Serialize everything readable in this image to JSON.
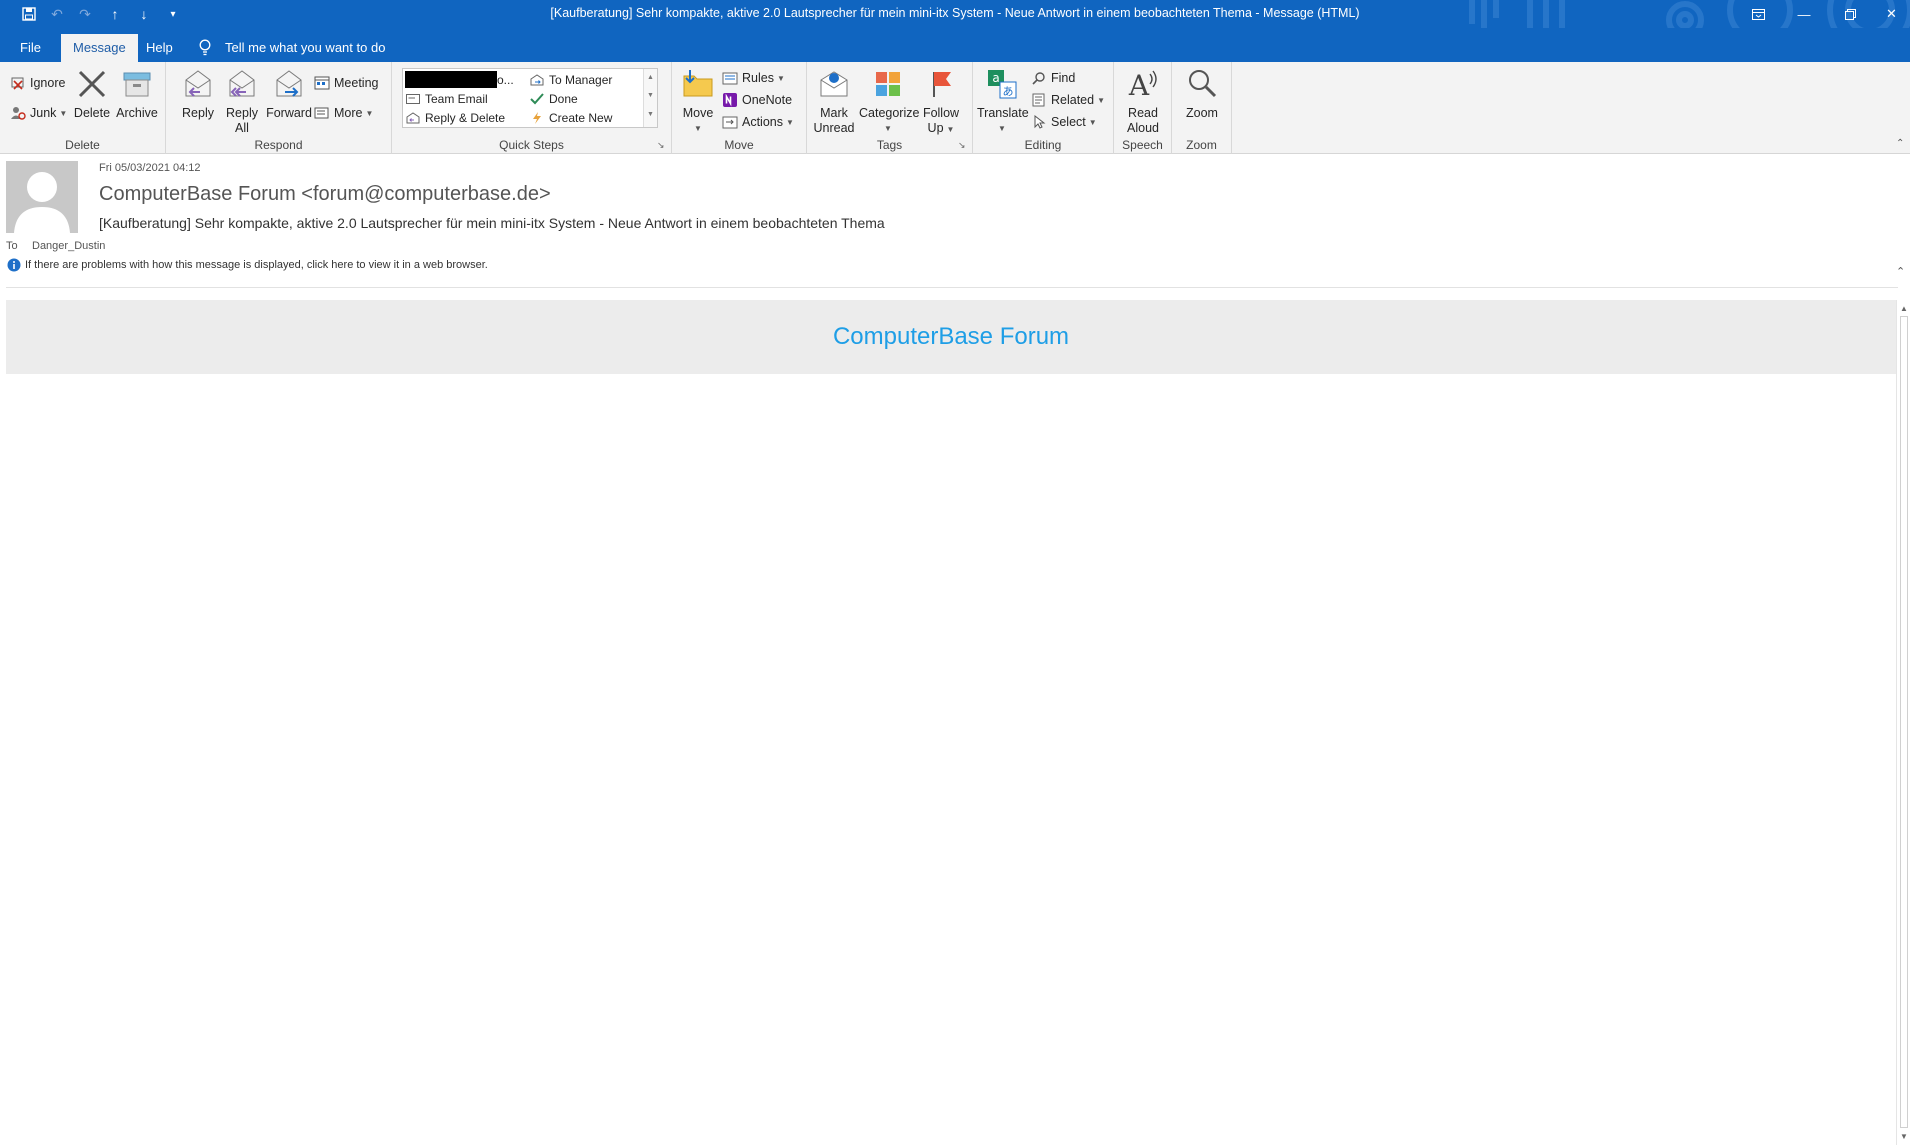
{
  "titlebar": {
    "title": "[Kaufberatung] Sehr kompakte, aktive 2.0 Lautsprecher für mein mini-itx System - Neue Antwort in einem beobachteten Thema  -  Message (HTML)",
    "accent": "#1065c0"
  },
  "tabs": {
    "file": "File",
    "message": "Message",
    "help": "Help",
    "tellme": "Tell me what you want to do"
  },
  "ribbon": {
    "delete_group": {
      "label": "Delete",
      "ignore": "Ignore",
      "junk": "Junk",
      "delete": "Delete",
      "archive": "Archive"
    },
    "respond_group": {
      "label": "Respond",
      "reply": "Reply",
      "reply_all_1": "Reply",
      "reply_all_2": "All",
      "forward": "Forward",
      "meeting": "Meeting",
      "more": "More"
    },
    "quicksteps_group": {
      "label": "Quick Steps",
      "redacted_suffix": "o...",
      "team_email": "Team Email",
      "reply_delete": "Reply & Delete",
      "to_manager": "To Manager",
      "done": "Done",
      "create_new": "Create New"
    },
    "move_group": {
      "label": "Move",
      "move": "Move",
      "rules": "Rules",
      "onenote": "OneNote",
      "actions": "Actions"
    },
    "tags_group": {
      "label": "Tags",
      "mark_unread_1": "Mark",
      "mark_unread_2": "Unread",
      "categorize": "Categorize",
      "follow_up_1": "Follow",
      "follow_up_2": "Up"
    },
    "editing_group": {
      "label": "Editing",
      "translate": "Translate",
      "find": "Find",
      "related": "Related",
      "select": "Select"
    },
    "speech_group": {
      "label": "Speech",
      "read_aloud_1": "Read",
      "read_aloud_2": "Aloud"
    },
    "zoom_group": {
      "label": "Zoom",
      "zoom": "Zoom"
    }
  },
  "message": {
    "date": "Fri 05/03/2021 04:12",
    "sender": "ComputerBase Forum <forum@computerbase.de>",
    "subject": "[Kaufberatung] Sehr kompakte, aktive 2.0 Lautsprecher für mein mini-itx System - Neue Antwort in einem beobachteten Thema",
    "to_label": "To",
    "to_value": "Danger_Dustin",
    "info_bar": "If there are problems with how this message is displayed, click here to view it in a web browser."
  },
  "body": {
    "banner_title": "ComputerBase Forum",
    "banner_color": "#1e9ee6"
  }
}
